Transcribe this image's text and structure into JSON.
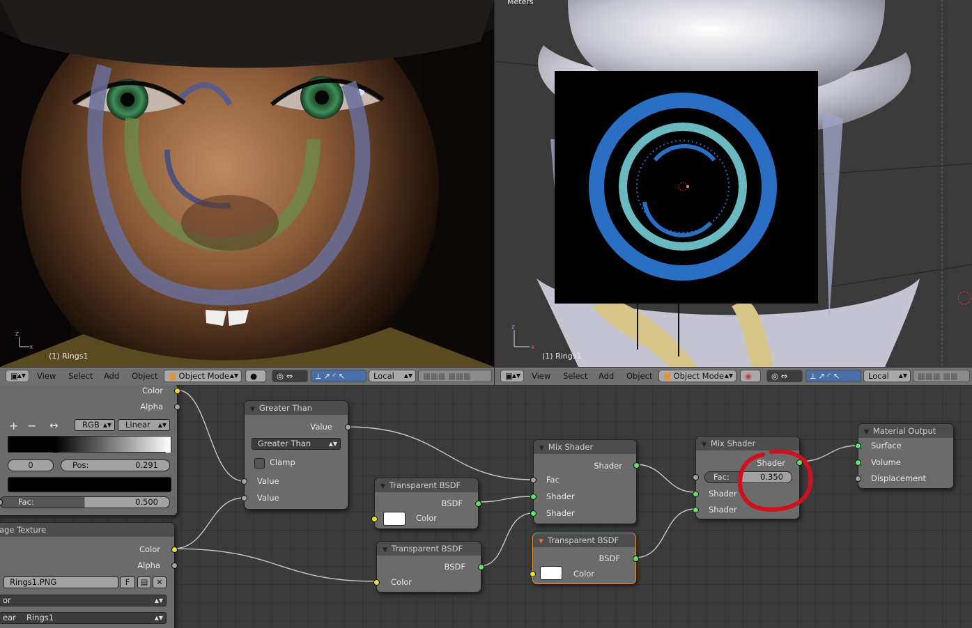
{
  "viewport_left": {
    "object_label": "(1) Rings1"
  },
  "viewport_right": {
    "units_label": "Meters",
    "object_label": "(1) Rings1"
  },
  "header_left": {
    "menu": [
      "View",
      "Select",
      "Add",
      "Object"
    ],
    "mode": "Object Mode",
    "orientation": "Local"
  },
  "header_right": {
    "menu": [
      "View",
      "Select",
      "Add",
      "Object"
    ],
    "mode": "Object Mode",
    "orientation": "Local"
  },
  "nodes": {
    "color_ramp": {
      "out_color": "Color",
      "out_alpha": "Alpha",
      "mode": "RGB",
      "interp": "Linear",
      "index": "0",
      "pos_label": "Pos:",
      "pos_value": "0.291",
      "fac_label": "Fac:",
      "fac_value": "0.500",
      "add_symbol": "+",
      "remove_symbol": "−",
      "flip_symbol": "↔"
    },
    "greater_than": {
      "title": "Greater Than",
      "out_value": "Value",
      "operation": "Greater Than",
      "clamp_label": "Clamp",
      "in_value1": "Value",
      "in_value2": "Value"
    },
    "image_texture": {
      "title": "age Texture",
      "out_color": "Color",
      "out_alpha": "Alpha",
      "image_name": "Rings1.PNG",
      "fake_user": "F",
      "color_mode_fragment": "or",
      "source_fragment": "ear",
      "source_name": "Rings1"
    },
    "transparent_1": {
      "title": "Transparent BSDF",
      "out_bsdf": "BSDF",
      "in_color": "Color"
    },
    "transparent_2": {
      "title": "Transparent BSDF",
      "out_bsdf": "BSDF",
      "in_color": "Color"
    },
    "transparent_3": {
      "title": "Transparent BSDF",
      "out_bsdf": "BSDF",
      "in_color": "Color"
    },
    "mix_1": {
      "title": "Mix Shader",
      "out_shader": "Shader",
      "in_fac": "Fac",
      "in_shader1": "Shader",
      "in_shader2": "Shader"
    },
    "mix_2": {
      "title": "Mix Shader",
      "out_shader": "Shader",
      "fac_label": "Fac:",
      "fac_value": "0.350",
      "in_shader1": "Shader",
      "in_shader2": "Shader"
    },
    "material_output": {
      "title": "Material Output",
      "in_surface": "Surface",
      "in_volume": "Volume",
      "in_displacement": "Displacement"
    }
  },
  "colors": {
    "socket_shader": "#5fe06a",
    "socket_color": "#e8e030",
    "socket_value": "#a2a2a2",
    "annotation": "#d0101e",
    "active_node_border": "#e0903a"
  }
}
